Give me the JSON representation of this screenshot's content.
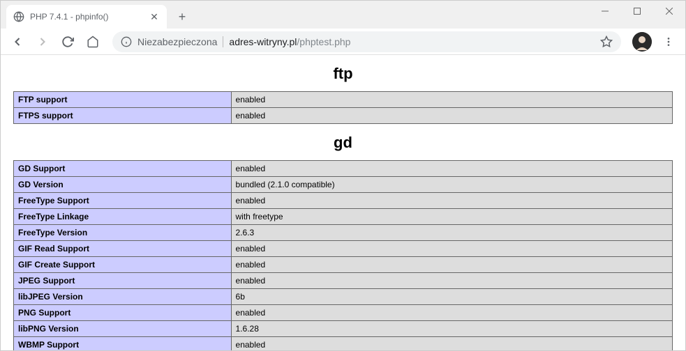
{
  "tab": {
    "title": "PHP 7.4.1 - phpinfo()"
  },
  "address": {
    "security_text": "Niezabezpieczona",
    "domain": "adres-witryny.pl",
    "path": "/phptest.php"
  },
  "sections": [
    {
      "heading": "ftp",
      "rows": [
        {
          "key": "FTP support",
          "val": "enabled"
        },
        {
          "key": "FTPS support",
          "val": "enabled"
        }
      ]
    },
    {
      "heading": "gd",
      "rows": [
        {
          "key": "GD Support",
          "val": "enabled"
        },
        {
          "key": "GD Version",
          "val": "bundled (2.1.0 compatible)"
        },
        {
          "key": "FreeType Support",
          "val": "enabled"
        },
        {
          "key": "FreeType Linkage",
          "val": "with freetype"
        },
        {
          "key": "FreeType Version",
          "val": "2.6.3"
        },
        {
          "key": "GIF Read Support",
          "val": "enabled"
        },
        {
          "key": "GIF Create Support",
          "val": "enabled"
        },
        {
          "key": "JPEG Support",
          "val": "enabled"
        },
        {
          "key": "libJPEG Version",
          "val": "6b"
        },
        {
          "key": "PNG Support",
          "val": "enabled"
        },
        {
          "key": "libPNG Version",
          "val": "1.6.28"
        },
        {
          "key": "WBMP Support",
          "val": "enabled"
        }
      ]
    }
  ]
}
